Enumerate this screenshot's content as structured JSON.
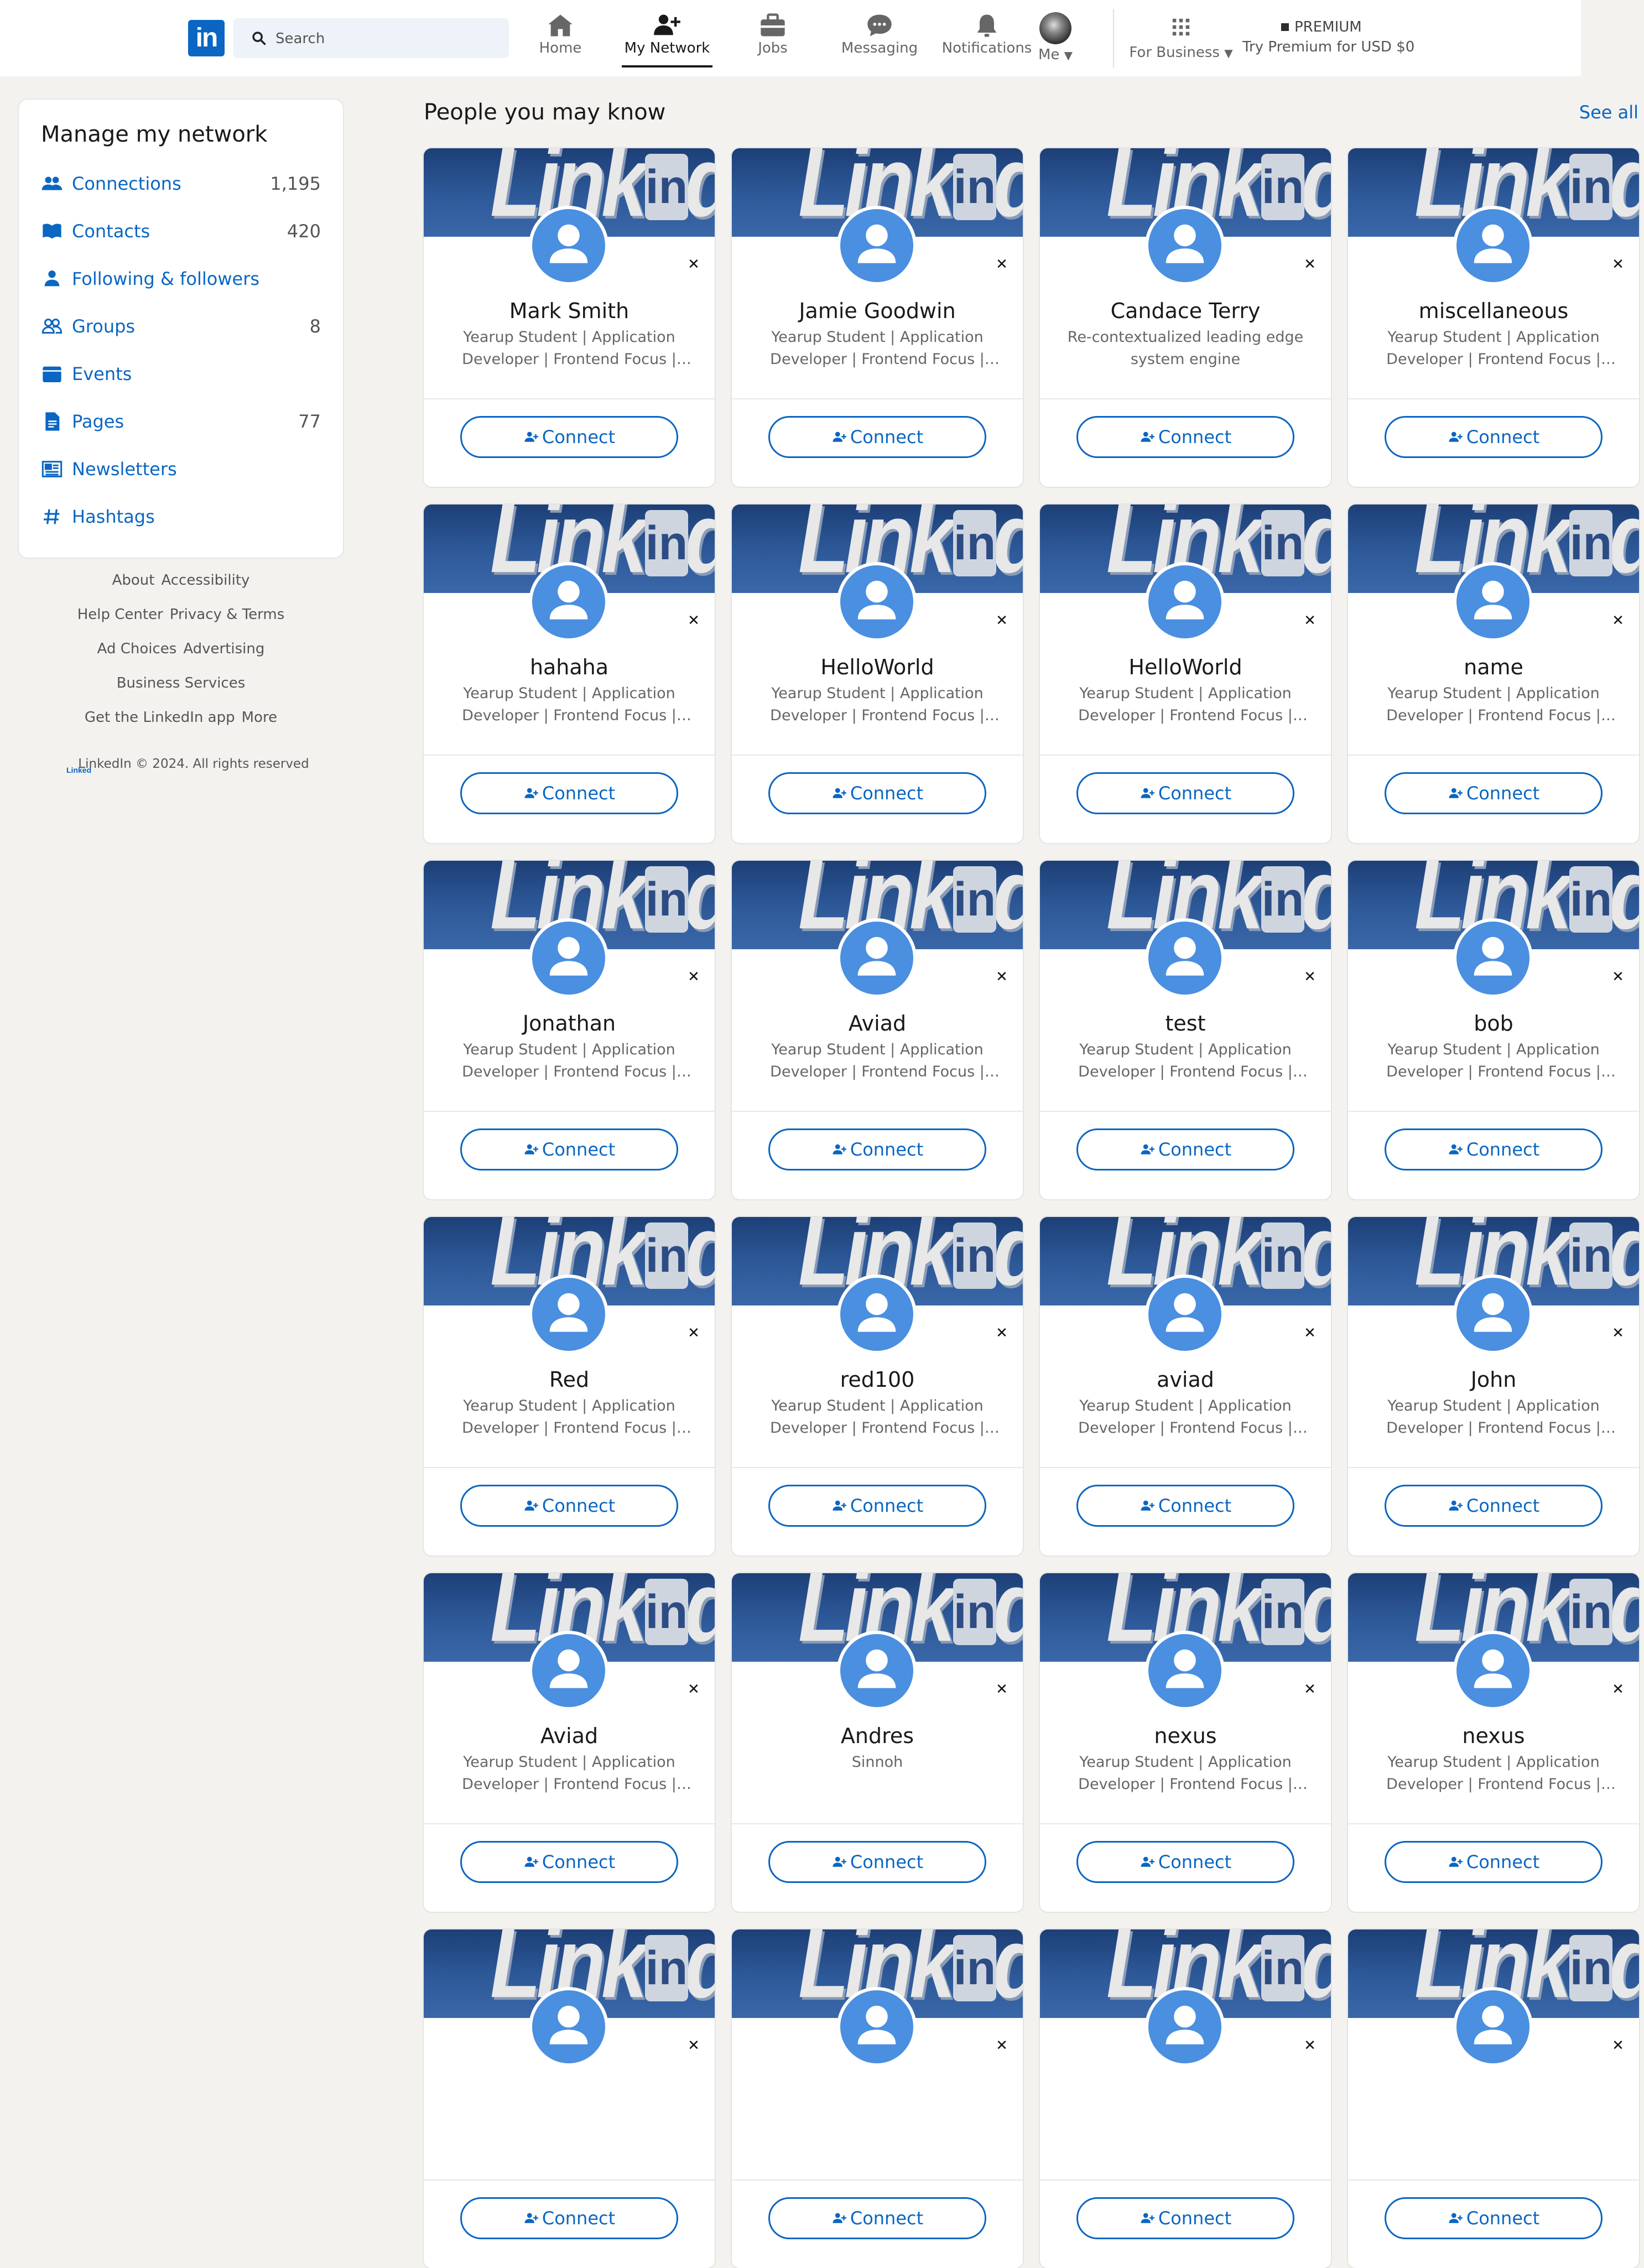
{
  "nav": {
    "search_placeholder": "Search",
    "items": [
      {
        "label": "Home",
        "icon": "home-icon"
      },
      {
        "label": "My Network",
        "icon": "my-network-icon",
        "active": true
      },
      {
        "label": "Jobs",
        "icon": "jobs-icon"
      },
      {
        "label": "Messaging",
        "icon": "messaging-icon"
      },
      {
        "label": "Notifications",
        "icon": "notifications-icon"
      },
      {
        "label": "Me",
        "icon": "avatar"
      },
      {
        "label": "For Business",
        "icon": "grid-icon"
      }
    ],
    "premium_badge": "PREMIUM",
    "premium_text": "Try Premium for USD $0"
  },
  "manage": {
    "title": "Manage my network",
    "items": [
      {
        "label": "Connections",
        "count": "1,195",
        "icon": "people-icon"
      },
      {
        "label": "Contacts",
        "count": "420",
        "icon": "book-icon"
      },
      {
        "label": "Following & followers",
        "count": "",
        "icon": "person-icon"
      },
      {
        "label": "Groups",
        "count": "8",
        "icon": "group-icon"
      },
      {
        "label": "Events",
        "count": "",
        "icon": "calendar-icon"
      },
      {
        "label": "Pages",
        "count": "77",
        "icon": "page-icon"
      },
      {
        "label": "Newsletters",
        "count": "",
        "icon": "newspaper-icon"
      },
      {
        "label": "Hashtags",
        "count": "",
        "icon": "hashtag-icon"
      }
    ]
  },
  "footer": {
    "lines": [
      [
        "About",
        "Accessibility"
      ],
      [
        "Help Center",
        "Privacy & Terms"
      ],
      [
        "Ad Choices",
        "Advertising"
      ],
      [
        "Business Services"
      ],
      [
        "Get the LinkedIn app",
        "More"
      ]
    ],
    "copyright": "LinkedIn © 2024. All rights reserved"
  },
  "main": {
    "section_title": "People you may know",
    "see_all": "See all",
    "connect_label": "Connect",
    "people": [
      {
        "name": "Mark Smith",
        "desc": "Yearup Student | Application Developer | Frontend Focus | Future"
      },
      {
        "name": "Jamie Goodwin",
        "desc": "Yearup Student | Application Developer | Frontend Focus | Future"
      },
      {
        "name": "Candace Terry",
        "desc": "Re-contextualized leading edge system engine"
      },
      {
        "name": "miscellaneous",
        "desc": "Yearup Student | Application Developer | Frontend Focus | Future"
      },
      {
        "name": "hahaha",
        "desc": "Yearup Student | Application Developer | Frontend Focus | Future"
      },
      {
        "name": "HelloWorld",
        "desc": "Yearup Student | Application Developer | Frontend Focus | Future"
      },
      {
        "name": "HelloWorld",
        "desc": "Yearup Student | Application Developer | Frontend Focus | Future"
      },
      {
        "name": "name",
        "desc": "Yearup Student | Application Developer | Frontend Focus | Future"
      },
      {
        "name": "Jonathan",
        "desc": "Yearup Student | Application Developer | Frontend Focus | Future"
      },
      {
        "name": "Aviad",
        "desc": "Yearup Student | Application Developer | Frontend Focus | Future"
      },
      {
        "name": "test",
        "desc": "Yearup Student | Application Developer | Frontend Focus | Future"
      },
      {
        "name": "bob",
        "desc": "Yearup Student | Application Developer | Frontend Focus | Future"
      },
      {
        "name": "Red",
        "desc": "Yearup Student | Application Developer | Frontend Focus | Future"
      },
      {
        "name": "red100",
        "desc": "Yearup Student | Application Developer | Frontend Focus | Future"
      },
      {
        "name": "aviad",
        "desc": "Yearup Student | Application Developer | Frontend Focus | Future"
      },
      {
        "name": "John",
        "desc": "Yearup Student | Application Developer | Frontend Focus | Future"
      },
      {
        "name": "Aviad",
        "desc": "Yearup Student | Application Developer | Frontend Focus | Future"
      },
      {
        "name": "Andres",
        "desc": "Sinnoh"
      },
      {
        "name": "nexus",
        "desc": "Yearup Student | Application Developer | Frontend Focus | Future"
      },
      {
        "name": "nexus",
        "desc": "Yearup Student | Application Developer | Frontend Focus | Future"
      },
      {
        "name": "",
        "desc": ""
      },
      {
        "name": "",
        "desc": ""
      },
      {
        "name": "",
        "desc": ""
      },
      {
        "name": "",
        "desc": ""
      }
    ]
  },
  "colors": {
    "brand": "#0a66c2",
    "avatar": "#4a8fe0",
    "page_bg": "#f3f2ef"
  }
}
